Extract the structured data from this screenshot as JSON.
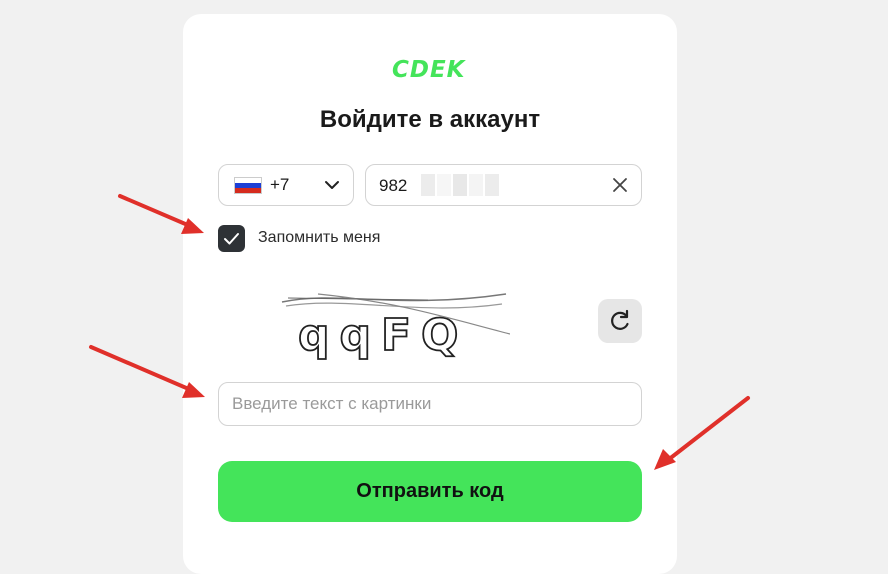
{
  "brand": {
    "logo_text": "CDEK",
    "accent": "#44e45a"
  },
  "login": {
    "title": "Войдите в аккаунт",
    "country": {
      "code": "+7",
      "flag": "russia-flag"
    },
    "phone": {
      "value": "982"
    },
    "remember": {
      "label": "Запомнить меня",
      "checked": true
    },
    "captcha": {
      "image_text": "qqFQ"
    },
    "captcha_input": {
      "placeholder": "Введите текст с картинки",
      "value": ""
    },
    "submit_label": "Отправить код"
  },
  "colors": {
    "annotation_arrow": "#e0302a",
    "checkbox": "#2e3236"
  }
}
